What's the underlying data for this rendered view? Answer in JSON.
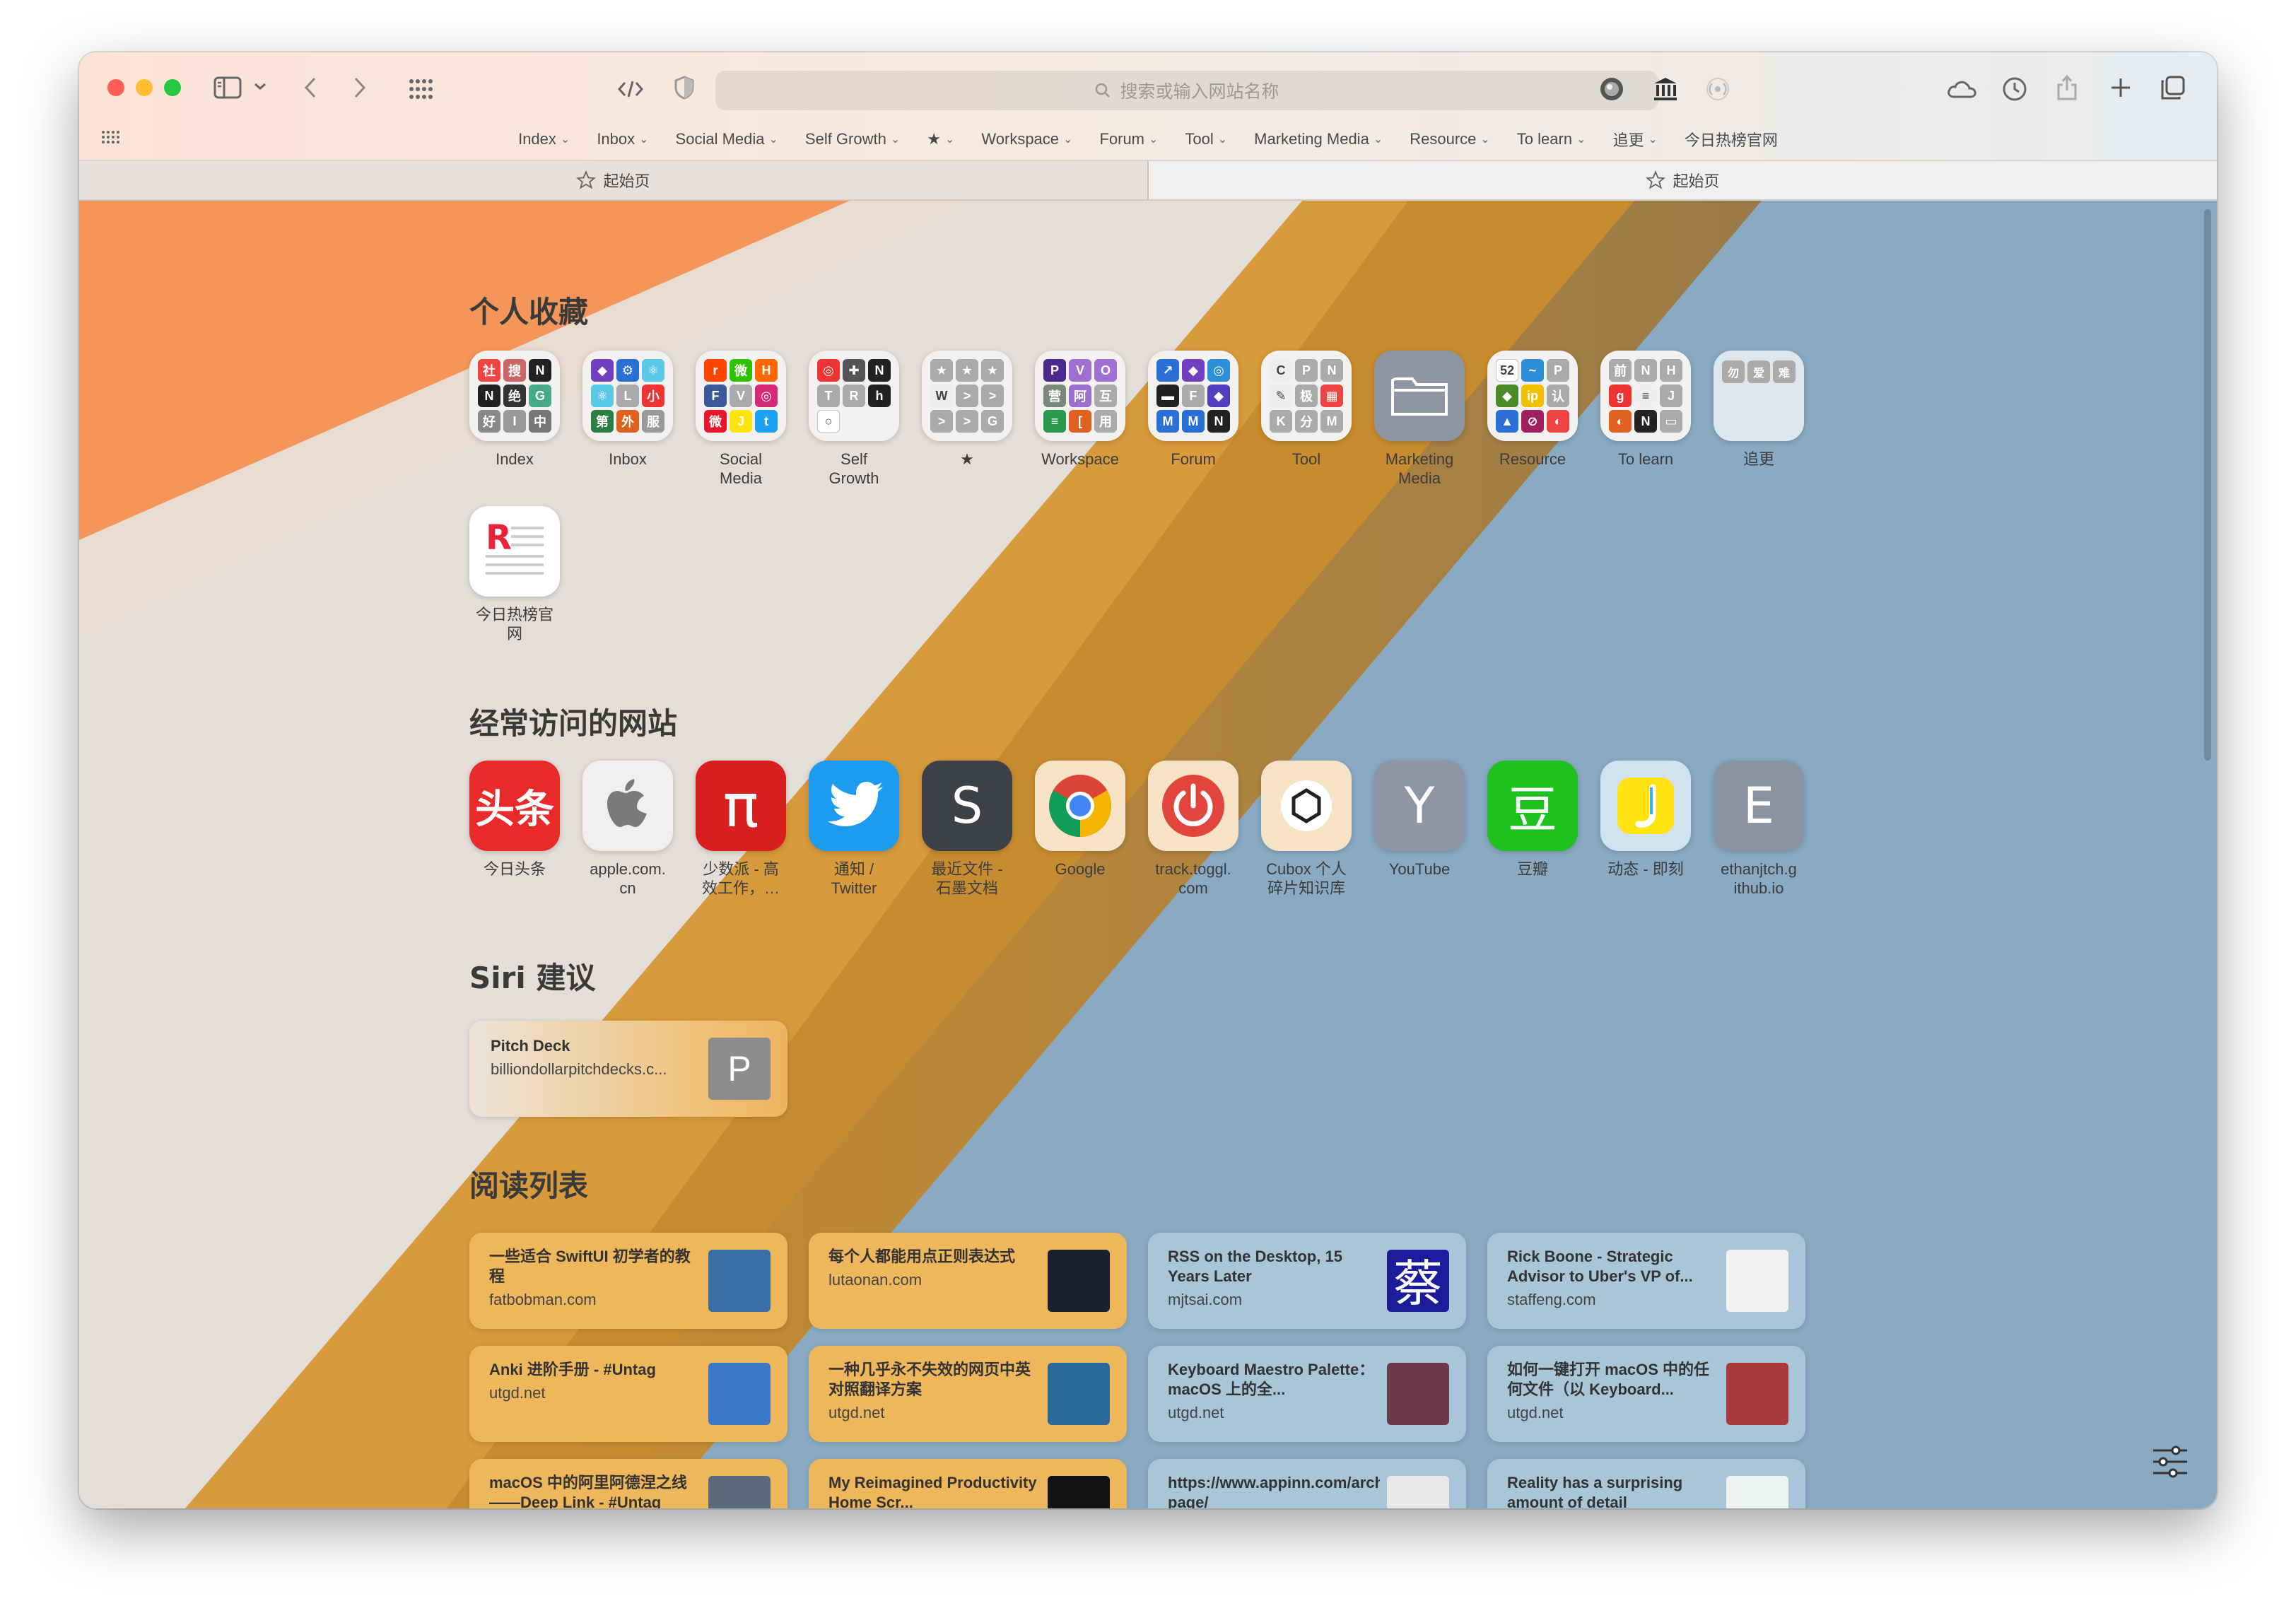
{
  "toolbar": {
    "search_placeholder": "搜索或输入网站名称",
    "favorites": [
      {
        "label": "Index",
        "chevron": true
      },
      {
        "label": "Inbox",
        "chevron": true
      },
      {
        "label": "Social Media",
        "chevron": true
      },
      {
        "label": "Self Growth",
        "chevron": true
      },
      {
        "label": "★",
        "chevron": true
      },
      {
        "label": "Workspace",
        "chevron": true
      },
      {
        "label": "Forum",
        "chevron": true
      },
      {
        "label": "Tool",
        "chevron": true
      },
      {
        "label": "Marketing Media",
        "chevron": true
      },
      {
        "label": "Resource",
        "chevron": true
      },
      {
        "label": "To learn",
        "chevron": true
      },
      {
        "label": "追更",
        "chevron": true
      },
      {
        "label": "今日热榜官网",
        "chevron": false
      }
    ],
    "chevron_glyph": "⌄"
  },
  "tabs": [
    {
      "label": "起始页",
      "active": false
    },
    {
      "label": "起始页",
      "active": true
    }
  ],
  "sections": {
    "favorites_title": "个人收藏",
    "frequent_title": "经常访问的网站",
    "siri_title": "Siri 建议",
    "reading_title": "阅读列表"
  },
  "favorites": [
    {
      "label": "Index",
      "cells": [
        [
          "社",
          "#e44"
        ],
        [
          "搜",
          "#c66"
        ],
        [
          "N",
          "#222"
        ],
        [
          "N",
          "#222"
        ],
        [
          "绝",
          "#333"
        ],
        [
          "G",
          "#4a8"
        ],
        [
          "好",
          "#888"
        ],
        [
          "I",
          "#999"
        ],
        [
          "中",
          "#777"
        ]
      ]
    },
    {
      "label": "Inbox",
      "cells": [
        [
          "◆",
          "#7040c0"
        ],
        [
          "⚙",
          "#2a6fd6"
        ],
        [
          "⚛",
          "#5cc8e8"
        ],
        [
          "⚛",
          "#5cc8e8"
        ],
        [
          "L",
          "#aaa"
        ],
        [
          "小",
          "#e33"
        ],
        [
          "第",
          "#2a8040"
        ],
        [
          "外",
          "#e06020"
        ],
        [
          "服",
          "#999"
        ]
      ]
    },
    {
      "label": "Social\nMedia",
      "cells": [
        [
          "r",
          "#ff4500"
        ],
        [
          "微",
          "#2dc100"
        ],
        [
          "H",
          "#ff6600"
        ],
        [
          "F",
          "#3b5998"
        ],
        [
          "V",
          "#aaa"
        ],
        [
          "◎",
          "#d62976"
        ],
        [
          "微",
          "#e6162d"
        ],
        [
          "J",
          "#ffe411"
        ],
        [
          "t",
          "#1da1f2"
        ]
      ]
    },
    {
      "label": "Self\nGrowth",
      "cells": [
        [
          "◎",
          "#e33"
        ],
        [
          "✚",
          "#555"
        ],
        [
          "N",
          "#222"
        ],
        [
          "T",
          "#aaa"
        ],
        [
          "R",
          "#aaa"
        ],
        [
          "h",
          "#222"
        ],
        [
          "○",
          "#fff"
        ],
        [
          "",
          ""
        ],
        [
          "",
          ""
        ]
      ]
    },
    {
      "label": "★",
      "cells": [
        [
          "★",
          "#aaa"
        ],
        [
          "★",
          "#aaa"
        ],
        [
          "★",
          "#aaa"
        ],
        [
          "W",
          "#eee"
        ],
        [
          ">",
          "#aaa"
        ],
        [
          ">",
          "#aaa"
        ],
        [
          ">",
          "#aaa"
        ],
        [
          ">",
          "#aaa"
        ],
        [
          "G",
          "#aaa"
        ]
      ]
    },
    {
      "label": "Workspace",
      "cells": [
        [
          "P",
          "#4a2a8a"
        ],
        [
          "V",
          "#a070d0"
        ],
        [
          "O",
          "#a070d0"
        ],
        [
          "营",
          "#7a8a7a"
        ],
        [
          "阿",
          "#9a70d0"
        ],
        [
          "互",
          "#aaa"
        ],
        [
          "≡",
          "#2a9a4a"
        ],
        [
          "[",
          "#e06020"
        ],
        [
          "用",
          "#aaa"
        ]
      ]
    },
    {
      "label": "Forum",
      "cells": [
        [
          "↗",
          "#2a6fd6"
        ],
        [
          "◆",
          "#7040c0"
        ],
        [
          "◎",
          "#2a8fd6"
        ],
        [
          "▬",
          "#222"
        ],
        [
          "F",
          "#aaa"
        ],
        [
          "◆",
          "#5040c0"
        ],
        [
          "M",
          "#2a6fd6"
        ],
        [
          "M",
          "#2a6fd6"
        ],
        [
          "N",
          "#222"
        ]
      ]
    },
    {
      "label": "Tool",
      "cells": [
        [
          "C",
          "#eee"
        ],
        [
          "P",
          "#aaa"
        ],
        [
          "N",
          "#aaa"
        ],
        [
          "✎",
          "#eee"
        ],
        [
          "极",
          "#aaa"
        ],
        [
          "▦",
          "#e44"
        ],
        [
          "K",
          "#aaa"
        ],
        [
          "分",
          "#aaa"
        ],
        [
          "M",
          "#aaa"
        ]
      ]
    },
    {
      "label": "Marketing\nMedia",
      "cells": []
    },
    {
      "label": "Resource",
      "cells": [
        [
          "52",
          "#fff"
        ],
        [
          "~",
          "#2a8fd6"
        ],
        [
          "P",
          "#aaa"
        ],
        [
          "◆",
          "#4a8a2a"
        ],
        [
          "ip",
          "#f0c000"
        ],
        [
          "认",
          "#aaa"
        ],
        [
          "▲",
          "#2a6fd6"
        ],
        [
          "⊘",
          "#a02060"
        ],
        [
          "◐",
          "#e44"
        ]
      ]
    },
    {
      "label": "To learn",
      "cells": [
        [
          "前",
          "#aaa"
        ],
        [
          "N",
          "#aaa"
        ],
        [
          "H",
          "#aaa"
        ],
        [
          "g",
          "#e33"
        ],
        [
          "≡",
          "#eee"
        ],
        [
          "J",
          "#aaa"
        ],
        [
          "◐",
          "#e06020"
        ],
        [
          "N",
          "#222"
        ],
        [
          "▭",
          "#aaa"
        ]
      ]
    },
    {
      "label": "追更",
      "cells": [
        [
          "勿",
          "#aaa"
        ],
        [
          "爱",
          "#aaa"
        ],
        [
          "难",
          "#aaa"
        ]
      ]
    },
    {
      "label": "今日热榜官\n网",
      "cells": []
    }
  ],
  "frequent": [
    {
      "label": "今日头条",
      "glyph": "头条",
      "bg": "#e82a2a"
    },
    {
      "label": "apple.com.\ncn",
      "glyph": "",
      "bg": "#f0efed"
    },
    {
      "label": "少数派 - 高\n效工作，…",
      "glyph": "π",
      "bg": "#d81e1e"
    },
    {
      "label": "通知 /\nTwitter",
      "glyph": "",
      "bg": "#1d9bf0"
    },
    {
      "label": "最近文件 -\n石墨文档",
      "glyph": "S",
      "bg": "#3d4045"
    },
    {
      "label": "Google",
      "glyph": "",
      "bg": "#f6e3c5"
    },
    {
      "label": "track.toggl.\ncom",
      "glyph": "⏻",
      "bg": "#f6e3c5"
    },
    {
      "label": "Cubox 个人\n碎片知识库",
      "glyph": "",
      "bg": "#f6e3c5"
    },
    {
      "label": "YouTube",
      "glyph": "Y",
      "bg": "#8e96a3"
    },
    {
      "label": "豆瓣",
      "glyph": "豆",
      "bg": "#1ec21e"
    },
    {
      "label": "动态 - 即刻",
      "glyph": "J",
      "bg": "#cfe2ee"
    },
    {
      "label": "ethanjtch.g\nithub.io",
      "glyph": "E",
      "bg": "#8a93a0"
    }
  ],
  "siri": {
    "title": "Pitch Deck",
    "subtitle": "billiondollarpitchdecks.c...",
    "letter": "P"
  },
  "reading": [
    {
      "title": "一些适合 SwiftUI 初学者的教程",
      "site": "fatbobman.com",
      "bg": "#efb75c",
      "thumb": "#3a6ea8"
    },
    {
      "title": "每个人都能用点正则表达式",
      "site": "lutaonan.com",
      "bg": "#efb75c",
      "thumb": "#1c2030"
    },
    {
      "title": "RSS on the Desktop, 15 Years Later",
      "site": "mjtsai.com",
      "bg": "#a9c6d8",
      "thumb": "#1c1c9a"
    },
    {
      "title": "Rick Boone - Strategic Advisor to Uber's VP of...",
      "site": "staffeng.com",
      "bg": "#a9c6d8",
      "thumb": "#f2f2f2"
    },
    {
      "title": "Anki 进阶手册 - #Untag",
      "site": "utgd.net",
      "bg": "#efb75c",
      "thumb": "#3a7ac8"
    },
    {
      "title": "一种几乎永不失效的网页中英对照翻译方案",
      "site": "utgd.net",
      "bg": "#efb75c",
      "thumb": "#2a6a9a"
    },
    {
      "title": "Keyboard Maestro Palette：macOS 上的全...",
      "site": "utgd.net",
      "bg": "#a9c6d8",
      "thumb": "#6a3a4a"
    },
    {
      "title": "如何一键打开 macOS 中的任何文件（以 Keyboard...",
      "site": "utgd.net",
      "bg": "#a9c6d8",
      "thumb": "#a83a3a"
    },
    {
      "title": "macOS 中的阿里阿德涅之线——Deep Link - #Untag",
      "site": "",
      "bg": "#efb75c",
      "thumb": "#5a6a7a"
    },
    {
      "title": "My Reimagined Productivity Home Scr...",
      "site": "",
      "bg": "#efb75c",
      "thumb": "#121212"
    },
    {
      "title": "https://www.appinn.com/archiveweb-page/",
      "site": "",
      "bg": "#a9c6d8",
      "thumb": "#e8e8e8"
    },
    {
      "title": "Reality has a surprising amount of detail",
      "site": "",
      "bg": "#a9c6d8",
      "thumb": "#eef2f0"
    }
  ]
}
